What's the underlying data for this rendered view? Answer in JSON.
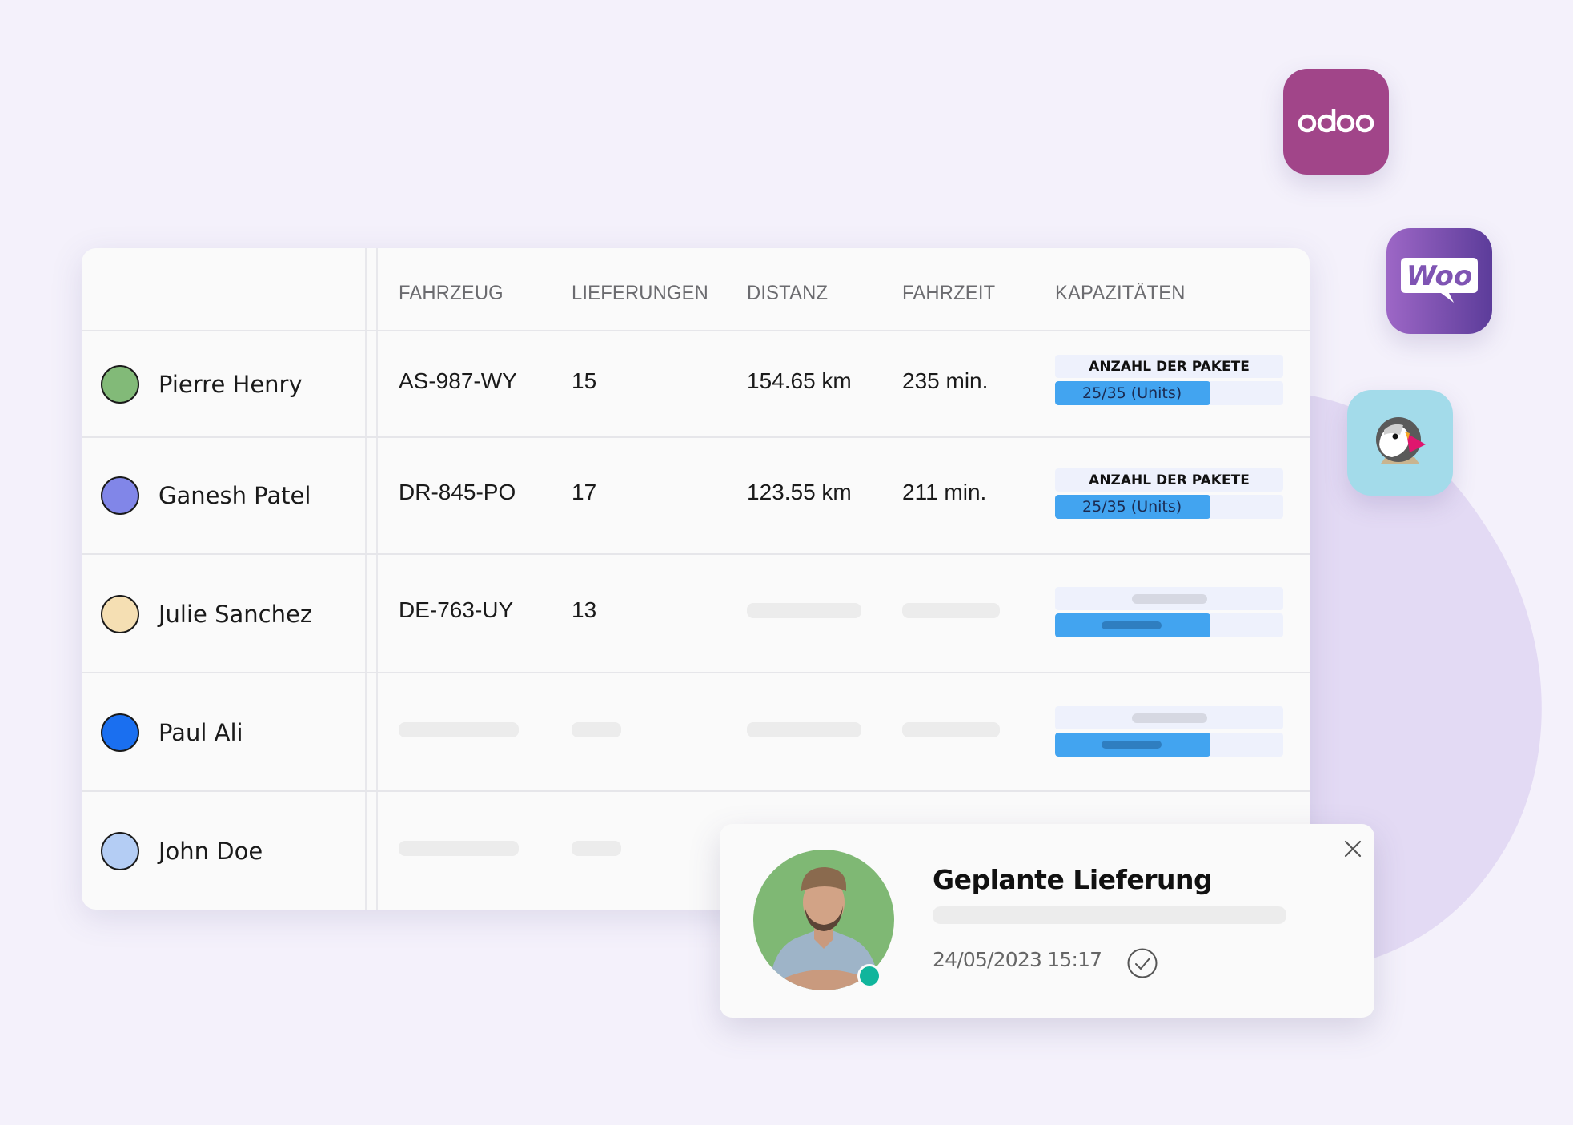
{
  "table": {
    "headers": {
      "vehicle": "FAHRZEUG",
      "deliveries": "LIEFERUNGEN",
      "distance": "DISTANZ",
      "drive_time": "FAHRZEIT",
      "capacities": "KAPAZITÄTEN"
    },
    "rows": [
      {
        "name": "Pierre Henry",
        "color": "#82ba78",
        "vehicle": "AS-987-WY",
        "deliveries": "15",
        "distance": "154.65 km",
        "drive_time": "235 min.",
        "capacity": {
          "label": "ANZAHL DER PAKETE",
          "value": "25/35 (Units)",
          "fill_fraction": 0.68
        }
      },
      {
        "name": "Ganesh Patel",
        "color": "#8186e8",
        "vehicle": "DR-845-PO",
        "deliveries": "17",
        "distance": "123.55 km",
        "drive_time": "211 min.",
        "capacity": {
          "label": "ANZAHL DER PAKETE",
          "value": "25/35 (Units)",
          "fill_fraction": 0.68
        }
      },
      {
        "name": "Julie Sanchez",
        "color": "#f5dfb3",
        "vehicle": "DE-763-UY",
        "deliveries": "13",
        "distance": null,
        "drive_time": null,
        "capacity": {
          "loading": true,
          "fill_fraction": 0.68
        }
      },
      {
        "name": "Paul Ali",
        "color": "#1a6ff0",
        "vehicle": null,
        "deliveries": null,
        "distance": null,
        "drive_time": null,
        "capacity": {
          "loading": true,
          "fill_fraction": 0.68
        }
      },
      {
        "name": "John Doe",
        "color": "#b4cdf4",
        "vehicle": null,
        "deliveries": null,
        "distance": null,
        "drive_time": null,
        "capacity": null
      }
    ]
  },
  "integrations": [
    {
      "name": "odoo",
      "label": "odoo",
      "color": "#a14589"
    },
    {
      "name": "woocommerce",
      "label": "Woo",
      "color": "#7f54b3"
    },
    {
      "name": "prestashop",
      "label": "",
      "color": "#a3dbea"
    }
  ],
  "notification": {
    "title": "Geplante Lieferung",
    "datetime": "24/05/2023 15:17",
    "status": "confirmed",
    "online": true,
    "avatar_bg": "#7fb874",
    "status_color": "#10b59c"
  }
}
